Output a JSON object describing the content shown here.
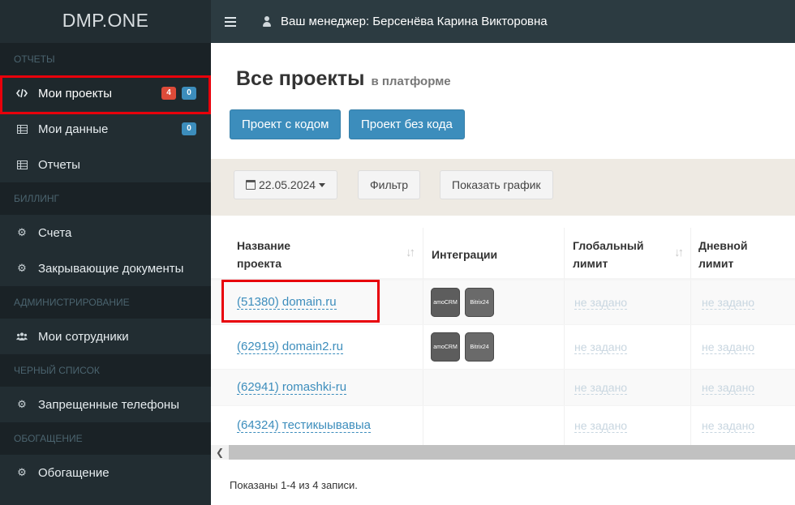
{
  "app": {
    "logo": "DMP.ONE"
  },
  "topbar": {
    "manager_text": "Ваш менеджер: Берсенёва Карина Викторовна"
  },
  "sidebar": {
    "sections": [
      {
        "header": "ОТЧЕТЫ",
        "items": [
          {
            "label": "Мои проекты",
            "icon": "code-icon",
            "badge_red": "4",
            "badge_blue": "0"
          },
          {
            "label": "Мои данные",
            "icon": "table-icon",
            "badge_blue": "0"
          },
          {
            "label": "Отчеты",
            "icon": "table-icon"
          }
        ]
      },
      {
        "header": "БИЛЛИНГ",
        "items": [
          {
            "label": "Счета",
            "icon": "gear-icon"
          },
          {
            "label": "Закрывающие документы",
            "icon": "gear-icon"
          }
        ]
      },
      {
        "header": "АДМИНИСТРИРОВАНИЕ",
        "items": [
          {
            "label": "Мои сотрудники",
            "icon": "users-icon"
          }
        ]
      },
      {
        "header": "ЧЕРНЫЙ СПИСОК",
        "items": [
          {
            "label": "Запрещенные телефоны",
            "icon": "gear-icon"
          }
        ]
      },
      {
        "header": "ОБОГАЩЕНИЕ",
        "items": [
          {
            "label": "Обогащение",
            "icon": "gear-icon"
          }
        ]
      }
    ]
  },
  "page": {
    "title": "Все проекты",
    "subtitle": "в платформе",
    "btn_with_code": "Проект с кодом",
    "btn_without_code": "Проект без кода"
  },
  "filters": {
    "date": "22.05.2024",
    "filter_label": "Фильтр",
    "chart_label": "Показать график"
  },
  "table": {
    "columns": [
      "Название проекта",
      "Интеграции",
      "Глобальный лимит",
      "Дневной лимит"
    ],
    "col1_line1": "Название",
    "col1_line2": "проекта",
    "col3_line1": "Глобальный",
    "col3_line2": "лимит",
    "col4_line1": "Дневной",
    "col4_line2": "лимит",
    "rows": [
      {
        "name": "(51380) domain.ru",
        "integrations": [
          "amoCRM",
          "Bitrix24"
        ],
        "global": "не задано",
        "daily": "не задано"
      },
      {
        "name": "(62919) domain2.ru",
        "integrations": [
          "amoCRM",
          "Bitrix24"
        ],
        "global": "не задано",
        "daily": "не задано"
      },
      {
        "name": "(62941) romashki-ru",
        "integrations": [],
        "global": "не задано",
        "daily": "не задано"
      },
      {
        "name": "(64324) тестикыывавыа",
        "integrations": [],
        "global": "не задано",
        "daily": "не задано"
      }
    ],
    "footer": "Показаны 1-4 из 4 записи."
  },
  "colors": {
    "accent": "#3c8dbc",
    "sidebar": "#222d32",
    "highlight": "#e8000b",
    "badge_red": "#dd4b39"
  }
}
